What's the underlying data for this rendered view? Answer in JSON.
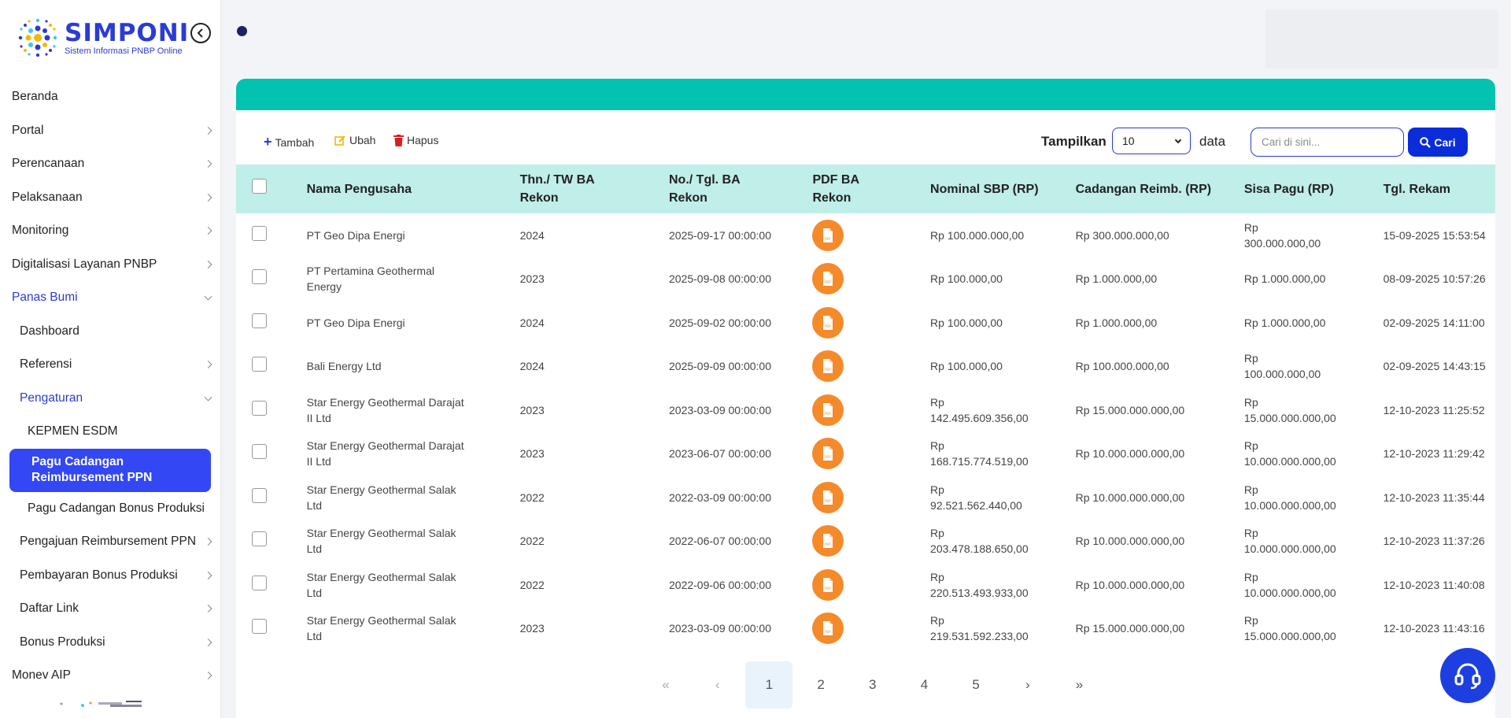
{
  "logo": {
    "title": "SIMPONI",
    "subtitle": "Sistem Informasi PNBP Online"
  },
  "nav": {
    "beranda": "Beranda",
    "portal": "Portal",
    "perencanaan": "Perencanaan",
    "pelaksanaan": "Pelaksanaan",
    "monitoring": "Monitoring",
    "digitalisasi": "Digitalisasi Layanan PNBP",
    "panas_bumi": "Panas Bumi",
    "dashboard": "Dashboard",
    "referensi": "Referensi",
    "pengaturan": "Pengaturan",
    "kepmen": "KEPMEN ESDM",
    "pagu_ppn": "Pagu Cadangan Reimbursement PPN",
    "pagu_bonus": "Pagu Cadangan Bonus Produksi",
    "pengajuan": "Pengajuan Reimbursement PPN",
    "pembayaran": "Pembayaran Bonus Produksi",
    "daftar_link": "Daftar Link",
    "bonus": "Bonus Produksi",
    "monev": "Monev AIP"
  },
  "toolbar": {
    "tambah": "Tambah",
    "ubah": "Ubah",
    "hapus": "Hapus",
    "tampilkan": "Tampilkan",
    "page_size": "10",
    "data": "data",
    "search_placeholder": "Cari di sini...",
    "cari": "Cari"
  },
  "colors": {
    "accent": "#3347f5",
    "header_bar": "#02c2b0",
    "table_head": "#c0eee8",
    "pdf": "#f58a2b"
  },
  "table": {
    "headers": {
      "nama": "Nama Pengusaha",
      "thn": "Thn./ TW BA Rekon",
      "no": "No./ Tgl. BA Rekon",
      "pdf": "PDF BA Rekon",
      "nominal": "Nominal SBP (RP)",
      "cadangan": "Cadangan Reimb. (RP)",
      "sisa": "Sisa Pagu (RP)",
      "tgl": "Tgl. Rekam"
    },
    "rows": [
      {
        "nama": "PT Geo Dipa Energi",
        "thn": "2024",
        "no": "2025-09-17 00:00:00",
        "nominal": "Rp 100.000.000,00",
        "cadangan": "Rp 300.000.000,00",
        "sisa": "Rp 300.000.000,00",
        "tgl": "15-09-2025 15:53:54"
      },
      {
        "nama": "PT Pertamina Geothermal Energy",
        "thn": "2023",
        "no": "2025-09-08 00:00:00",
        "nominal": "Rp 100.000,00",
        "cadangan": "Rp 1.000.000,00",
        "sisa": "Rp 1.000.000,00",
        "tgl": "08-09-2025 10:57:26"
      },
      {
        "nama": "PT Geo Dipa Energi",
        "thn": "2024",
        "no": "2025-09-02 00:00:00",
        "nominal": "Rp 100.000,00",
        "cadangan": "Rp 1.000.000,00",
        "sisa": "Rp 1.000.000,00",
        "tgl": "02-09-2025 14:11:00"
      },
      {
        "nama": "Bali Energy Ltd",
        "thn": "2024",
        "no": "2025-09-09 00:00:00",
        "nominal": "Rp 100.000,00",
        "cadangan": "Rp 100.000.000,00",
        "sisa": "Rp 100.000.000,00",
        "tgl": "02-09-2025 14:43:15"
      },
      {
        "nama": "Star Energy Geothermal Darajat II Ltd",
        "thn": "2023",
        "no": "2023-03-09 00:00:00",
        "nominal": "Rp 142.495.609.356,00",
        "cadangan": "Rp 15.000.000.000,00",
        "sisa": "Rp 15.000.000.000,00",
        "tgl": "12-10-2023 11:25:52"
      },
      {
        "nama": "Star Energy Geothermal Darajat II Ltd",
        "thn": "2023",
        "no": "2023-06-07 00:00:00",
        "nominal": "Rp 168.715.774.519,00",
        "cadangan": "Rp 10.000.000.000,00",
        "sisa": "Rp 10.000.000.000,00",
        "tgl": "12-10-2023 11:29:42"
      },
      {
        "nama": "Star Energy Geothermal Salak Ltd",
        "thn": "2022",
        "no": "2022-03-09 00:00:00",
        "nominal": "Rp 92.521.562.440,00",
        "cadangan": "Rp 10.000.000.000,00",
        "sisa": "Rp 10.000.000.000,00",
        "tgl": "12-10-2023 11:35:44"
      },
      {
        "nama": "Star Energy Geothermal Salak Ltd",
        "thn": "2022",
        "no": "2022-06-07 00:00:00",
        "nominal": "Rp 203.478.188.650,00",
        "cadangan": "Rp 10.000.000.000,00",
        "sisa": "Rp 10.000.000.000,00",
        "tgl": "12-10-2023 11:37:26"
      },
      {
        "nama": "Star Energy Geothermal Salak Ltd",
        "thn": "2022",
        "no": "2022-09-06 00:00:00",
        "nominal": "Rp 220.513.493.933,00",
        "cadangan": "Rp 10.000.000.000,00",
        "sisa": "Rp 10.000.000.000,00",
        "tgl": "12-10-2023 11:40:08"
      },
      {
        "nama": "Star Energy Geothermal Salak Ltd",
        "thn": "2023",
        "no": "2023-03-09 00:00:00",
        "nominal": "Rp 219.531.592.233,00",
        "cadangan": "Rp 15.000.000.000,00",
        "sisa": "Rp 15.000.000.000,00",
        "tgl": "12-10-2023 11:43:16"
      }
    ]
  },
  "pagination": {
    "first": "«",
    "prev": "‹",
    "pages": [
      "1",
      "2",
      "3",
      "4",
      "5"
    ],
    "current": "1",
    "next": "›",
    "last": "»"
  }
}
